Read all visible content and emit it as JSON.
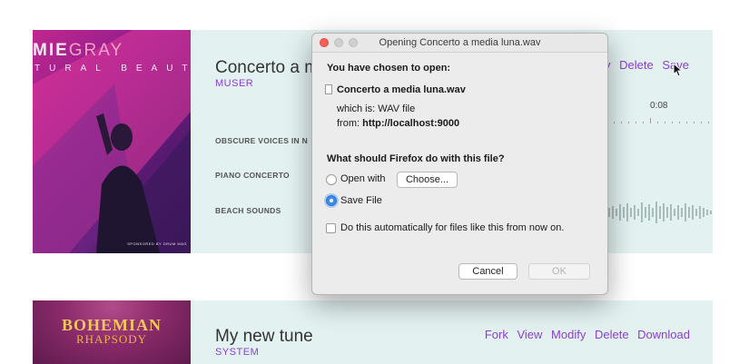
{
  "cards": [
    {
      "album": {
        "brand_primary": "MIE",
        "brand_secondary": "GRAY",
        "subtitle": "TURAL BEAUTY",
        "footer": "SPONSORED BY DRUM MAG"
      },
      "title": "Concerto a m",
      "author": "MUSER",
      "tracks": [
        "OBSCURE VOICES IN N",
        "PIANO CONCERTO",
        "BEACH SOUNDS"
      ],
      "actions": [
        "y",
        "Delete",
        "Save"
      ],
      "time": "0:08"
    },
    {
      "album": {
        "title": "BOHEMIAN",
        "subtitle": "RHAPSODY"
      },
      "title": "My new tune",
      "author": "SYSTEM",
      "actions": [
        "Fork",
        "View",
        "Modify",
        "Delete",
        "Download"
      ]
    }
  ],
  "dialog": {
    "title": "Opening Concerto a media luna.wav",
    "chosen_label": "You have chosen to open:",
    "filename": "Concerto a media luna.wav",
    "which_is": "which is:",
    "file_type": "WAV file",
    "from_label": "from:",
    "source": "http://localhost:9000",
    "question": "What should Firefox do with this file?",
    "open_with_label": "Open with",
    "choose_button": "Choose...",
    "save_file_label": "Save File",
    "auto_label": "Do this automatically for files like this from now on.",
    "cancel_button": "Cancel",
    "ok_button": "OK",
    "selected_option": "Save File",
    "auto_checked": false
  },
  "colors": {
    "accent": "#8b3fd1",
    "card_bg": "#e3f1f1",
    "radio_selected": "#3b8bf1"
  }
}
